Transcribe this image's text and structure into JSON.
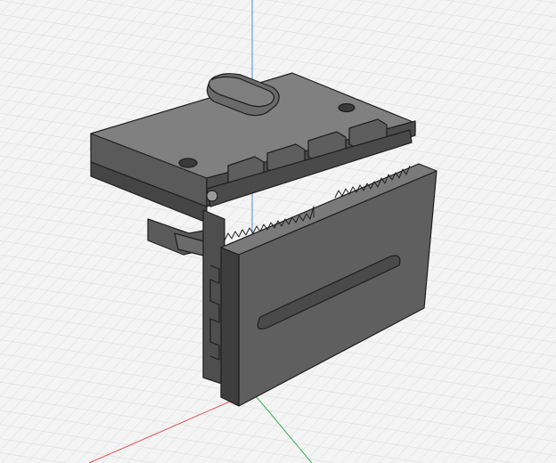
{
  "viewport": {
    "background": "#f4f4f4",
    "grid_color": "#d9d9d9",
    "axis_colors": {
      "x": "#e05050",
      "y": "#3cae5a",
      "z": "#4a8fe0"
    }
  },
  "model": {
    "colors": {
      "top": "#7d7d7d",
      "front": "#5c5c5c",
      "side": "#4a4a4a",
      "dark": "#3a3a3a",
      "edge": "#1e1e1e",
      "highlight": "#9a9a9a"
    }
  }
}
